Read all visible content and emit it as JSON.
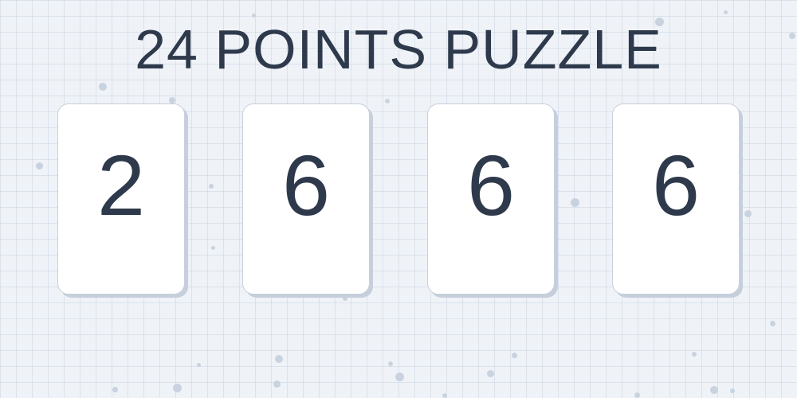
{
  "title": "24 POINTS PUZZLE",
  "cards": [
    {
      "value": "2"
    },
    {
      "value": "6"
    },
    {
      "value": "6"
    },
    {
      "value": "6"
    }
  ],
  "colors": {
    "background": "#eff3f8",
    "text": "#2e3a4c",
    "card": "#ffffff",
    "card_border": "#c7d0dc"
  }
}
